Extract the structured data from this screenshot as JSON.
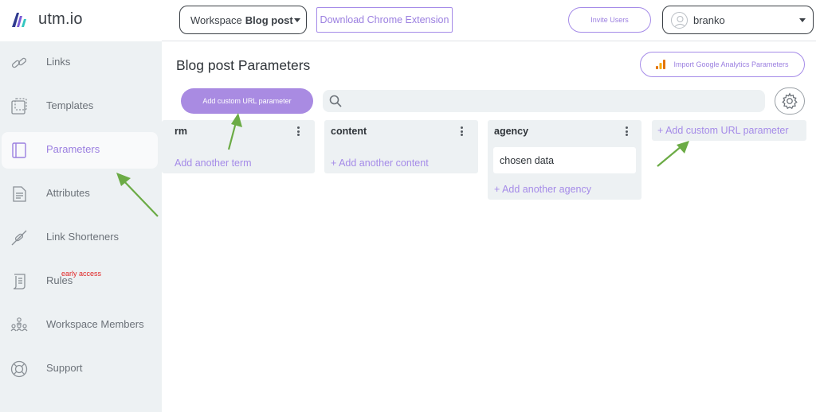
{
  "brand": {
    "name": "utm.io",
    "logo": "utm-logo-icon"
  },
  "sidebar": {
    "items": [
      {
        "label": "Links",
        "icon": "link-icon"
      },
      {
        "label": "Templates",
        "icon": "templates-icon"
      },
      {
        "label": "Parameters",
        "icon": "parameters-icon",
        "active": true
      },
      {
        "label": "Attributes",
        "icon": "attributes-icon"
      },
      {
        "label": "Link Shorteners",
        "icon": "link-shortener-icon"
      },
      {
        "label": "Rules",
        "icon": "rules-icon",
        "badge": "early access"
      },
      {
        "label": "Workspace Members",
        "icon": "members-icon"
      },
      {
        "label": "Support",
        "icon": "support-icon"
      }
    ]
  },
  "topbar": {
    "workspace_prefix": "Workspace",
    "workspace_name": "Blog post",
    "extension_label": "Download Chrome Extension",
    "invite_label": "Invite Users",
    "user_name": "branko"
  },
  "main": {
    "title": "Blog post Parameters",
    "import_label": "Import Google Analytics Parameters",
    "add_param_label": "Add custom URL parameter",
    "search_placeholder": "",
    "columns": [
      {
        "title": "rm",
        "add_label": "Add another term",
        "values": []
      },
      {
        "title": "content",
        "add_label": "+ Add another content",
        "values": []
      },
      {
        "title": "agency",
        "add_label": "+ Add another agency",
        "values": [
          "chosen data"
        ]
      }
    ],
    "add_column_label": "+ Add custom URL parameter"
  },
  "colors": {
    "accent": "#a98be2",
    "accent_text": "#9b7fe0",
    "sidebar_bg": "#edf1f3",
    "annotation_arrow": "#6bab45",
    "badge": "#e02424"
  }
}
